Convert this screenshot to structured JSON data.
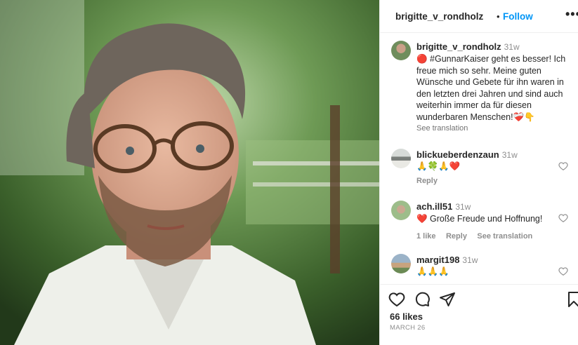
{
  "header": {
    "username": "brigitte_v_rondholz",
    "separator": "•",
    "follow_label": "Follow",
    "more_label": "•••"
  },
  "caption": {
    "username": "brigitte_v_rondholz",
    "time": "31w",
    "text": "🔴 #GunnarKaiser geht es besser! Ich freue mich so sehr. Meine guten Wünsche und Gebete für ihn waren in den letzten drei Jahren und sind auch weiterhin immer da für diesen wunderbaren Menschen!❤️‍🩹👇",
    "see_translation": "See translation"
  },
  "comments": [
    {
      "username": "blickueberdenzaun",
      "time": "31w",
      "text": "🙏🍀🙏❤️",
      "reply": "Reply"
    },
    {
      "username": "ach.ill51",
      "time": "31w",
      "text": "❤️ Große Freude und Hoffnung!",
      "likes": "1 like",
      "reply": "Reply",
      "see_translation": "See translation"
    },
    {
      "username": "margit198",
      "time": "31w",
      "text": "🙏🙏🙏"
    }
  ],
  "footer": {
    "likes": "66 likes",
    "date": "MARCH 26"
  },
  "icons": {
    "like": "heart-outline-icon",
    "comment": "comment-bubble-icon",
    "share": "paper-plane-icon",
    "save": "bookmark-icon"
  },
  "colors": {
    "accent": "#0095f6",
    "secondary_text": "#8e8e8e",
    "primary_text": "#262626"
  }
}
